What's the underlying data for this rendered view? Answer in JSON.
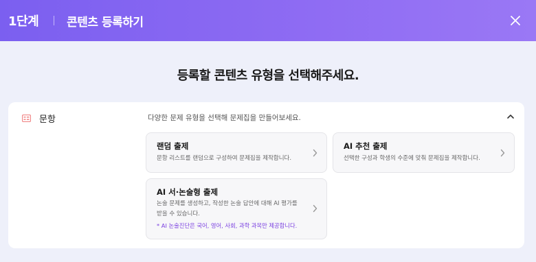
{
  "header": {
    "step": "1단계",
    "title": "콘텐츠 등록하기"
  },
  "main": {
    "title": "등록할 콘텐츠 유형을 선택해주세요."
  },
  "panel": {
    "category_label": "문항",
    "description": "다양한 문제 유형을 선택해 문제집을 만들어보세요.",
    "cards": [
      {
        "title": "랜덤 출제",
        "desc": "문항 리스트를 랜덤으로 구성하여 문제집을 제작합니다."
      },
      {
        "title": "AI 추천 출제",
        "desc": "선택한 구성과 학생의 수준에 맞춰 문제집을 제작합니다."
      },
      {
        "title": "AI 서·논술형 출제",
        "desc_line1": "논술 문제를 생성하고, 작성한 논술 답안에 대해 AI 평가를",
        "desc_line2": "받을 수 있습니다.",
        "note": "* AI 논술진단은 국어, 영어, 사회, 과학 과목만 제공합니다."
      }
    ]
  },
  "colors": {
    "header_gradient_start": "#7b5ff0",
    "header_gradient_end": "#9a78f5",
    "note_purple": "#7a3fe0",
    "category_icon": "#f08585"
  },
  "icons": {
    "close": "close-icon",
    "category": "category-list-icon",
    "collapse": "chevron-up-icon",
    "card_arrow": "chevron-right-icon"
  }
}
